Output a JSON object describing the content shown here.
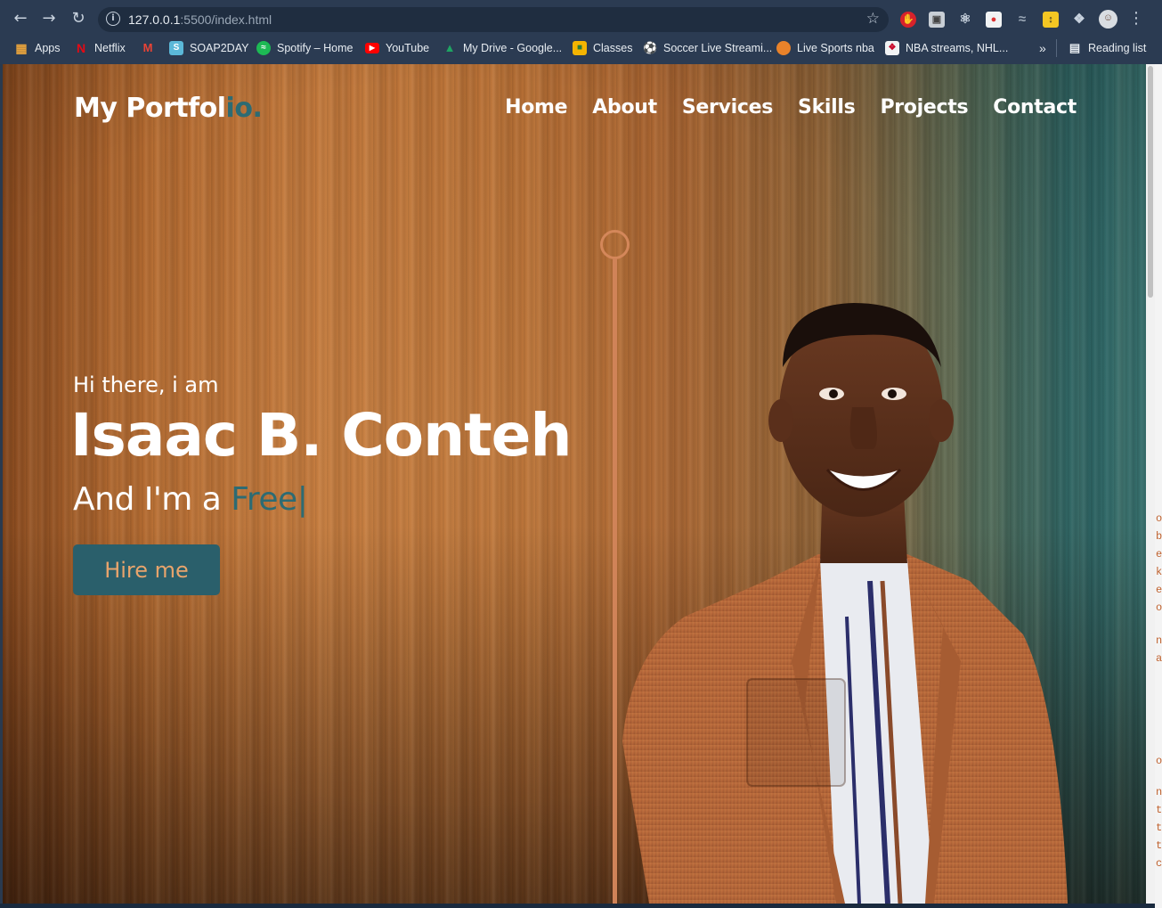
{
  "browser": {
    "url_host": "127.0.0.1",
    "url_rest": ":5500/index.html",
    "toolbar_icons": [
      "back-icon",
      "forward-icon",
      "reload-icon",
      "site-info-icon",
      "bookmark-star-icon",
      "extensions-icon",
      "profile-avatar",
      "menu-icon"
    ],
    "bookmarks": [
      {
        "label": "Apps",
        "icon": "apps-grid-icon",
        "color": "#e8a33c"
      },
      {
        "label": "Netflix",
        "icon": "netflix-icon",
        "color": "#e50914"
      },
      {
        "label": "",
        "icon": "gmail-icon",
        "color": "#ea4335"
      },
      {
        "label": "SOAP2DAY",
        "icon": "soap2day-icon",
        "color": "#5bb8d8"
      },
      {
        "label": "Spotify – Home",
        "icon": "spotify-icon",
        "color": "#1db954"
      },
      {
        "label": "YouTube",
        "icon": "youtube-icon",
        "color": "#ff0000"
      },
      {
        "label": "My Drive - Google...",
        "icon": "drive-icon",
        "color": "#1fa463"
      },
      {
        "label": "Classes",
        "icon": "classroom-icon",
        "color": "#f4b400"
      },
      {
        "label": "Soccer Live Streami...",
        "icon": "soccer-icon",
        "color": "#cfd8dc"
      },
      {
        "label": "Live Sports nba",
        "icon": "basketball-icon",
        "color": "#e8822a"
      },
      {
        "label": "NBA streams, NHL...",
        "icon": "nba-icon",
        "color": "#c9082a"
      }
    ],
    "overflow_label": "»",
    "reading_list_label": "Reading list"
  },
  "site": {
    "logo_main": "My Portfol",
    "logo_accent": "io.",
    "nav": [
      "Home",
      "About",
      "Services",
      "Skills",
      "Projects",
      "Contact"
    ],
    "greeting": "Hi there, i am",
    "name": "Isaac B. Conteh",
    "role_prefix": "And I'm a ",
    "role_typed": "Free",
    "role_cursor": "|",
    "cta": "Hire me"
  },
  "colors": {
    "accent": "#2d6b73",
    "button_bg": "#2a5f6b",
    "button_text": "#e8a46c",
    "deco_line": "#d08358"
  },
  "edge_letters": [
    "o",
    "b",
    "e",
    "k",
    "e",
    "o",
    "n",
    "a",
    "o",
    "n",
    "t",
    "t",
    "t",
    "c"
  ]
}
